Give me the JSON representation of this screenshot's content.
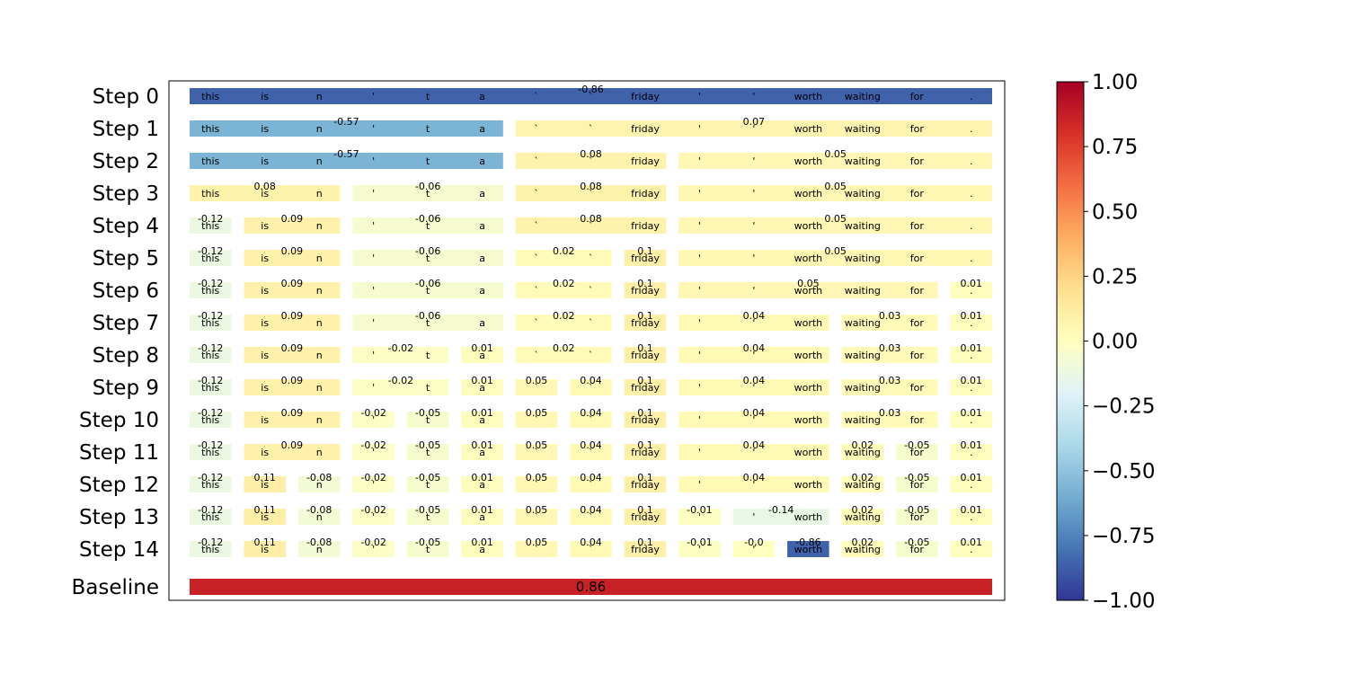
{
  "chart_data": {
    "type": "heatmap",
    "tokens": [
      "this",
      "is",
      "n",
      "'",
      "t",
      "a",
      "`",
      "`",
      "friday",
      "'",
      "'",
      "worth",
      "waiting",
      "for",
      "."
    ],
    "rows": [
      {
        "label": "Step 0",
        "segments": [
          {
            "start": 0,
            "end": 14,
            "value": -0.86
          }
        ]
      },
      {
        "label": "Step 1",
        "segments": [
          {
            "start": 0,
            "end": 5,
            "value": -0.57
          },
          {
            "start": 6,
            "end": 14,
            "value": 0.07
          }
        ]
      },
      {
        "label": "Step 2",
        "segments": [
          {
            "start": 0,
            "end": 5,
            "value": -0.57
          },
          {
            "start": 6,
            "end": 8,
            "value": 0.08
          },
          {
            "start": 9,
            "end": 14,
            "value": 0.05
          }
        ]
      },
      {
        "label": "Step 3",
        "segments": [
          {
            "start": 0,
            "end": 2,
            "value": 0.08
          },
          {
            "start": 3,
            "end": 5,
            "value": -0.06
          },
          {
            "start": 6,
            "end": 8,
            "value": 0.08
          },
          {
            "start": 9,
            "end": 14,
            "value": 0.05
          }
        ]
      },
      {
        "label": "Step 4",
        "segments": [
          {
            "start": 0,
            "end": 0,
            "value": -0.12
          },
          {
            "start": 1,
            "end": 2,
            "value": 0.09
          },
          {
            "start": 3,
            "end": 5,
            "value": -0.06
          },
          {
            "start": 6,
            "end": 8,
            "value": 0.08
          },
          {
            "start": 9,
            "end": 14,
            "value": 0.05
          }
        ]
      },
      {
        "label": "Step 5",
        "segments": [
          {
            "start": 0,
            "end": 0,
            "value": -0.12
          },
          {
            "start": 1,
            "end": 2,
            "value": 0.09
          },
          {
            "start": 3,
            "end": 5,
            "value": -0.06
          },
          {
            "start": 6,
            "end": 7,
            "value": 0.02
          },
          {
            "start": 8,
            "end": 8,
            "value": 0.1
          },
          {
            "start": 9,
            "end": 14,
            "value": 0.05
          }
        ]
      },
      {
        "label": "Step 6",
        "segments": [
          {
            "start": 0,
            "end": 0,
            "value": -0.12
          },
          {
            "start": 1,
            "end": 2,
            "value": 0.09
          },
          {
            "start": 3,
            "end": 5,
            "value": -0.06
          },
          {
            "start": 6,
            "end": 7,
            "value": 0.02
          },
          {
            "start": 8,
            "end": 8,
            "value": 0.1
          },
          {
            "start": 9,
            "end": 13,
            "value": 0.05
          },
          {
            "start": 14,
            "end": 14,
            "value": 0.01
          }
        ]
      },
      {
        "label": "Step 7",
        "segments": [
          {
            "start": 0,
            "end": 0,
            "value": -0.12
          },
          {
            "start": 1,
            "end": 2,
            "value": 0.09
          },
          {
            "start": 3,
            "end": 5,
            "value": -0.06
          },
          {
            "start": 6,
            "end": 7,
            "value": 0.02
          },
          {
            "start": 8,
            "end": 8,
            "value": 0.1
          },
          {
            "start": 9,
            "end": 11,
            "value": 0.04
          },
          {
            "start": 12,
            "end": 13,
            "value": 0.03
          },
          {
            "start": 14,
            "end": 14,
            "value": 0.01
          }
        ]
      },
      {
        "label": "Step 8",
        "segments": [
          {
            "start": 0,
            "end": 0,
            "value": -0.12
          },
          {
            "start": 1,
            "end": 2,
            "value": 0.09
          },
          {
            "start": 3,
            "end": 4,
            "value": -0.02
          },
          {
            "start": 5,
            "end": 5,
            "value": 0.01
          },
          {
            "start": 6,
            "end": 7,
            "value": 0.02
          },
          {
            "start": 8,
            "end": 8,
            "value": 0.1
          },
          {
            "start": 9,
            "end": 11,
            "value": 0.04
          },
          {
            "start": 12,
            "end": 13,
            "value": 0.03
          },
          {
            "start": 14,
            "end": 14,
            "value": 0.01
          }
        ]
      },
      {
        "label": "Step 9",
        "segments": [
          {
            "start": 0,
            "end": 0,
            "value": -0.12
          },
          {
            "start": 1,
            "end": 2,
            "value": 0.09
          },
          {
            "start": 3,
            "end": 4,
            "value": -0.02
          },
          {
            "start": 5,
            "end": 5,
            "value": 0.01
          },
          {
            "start": 6,
            "end": 6,
            "value": 0.05
          },
          {
            "start": 7,
            "end": 7,
            "value": 0.04
          },
          {
            "start": 8,
            "end": 8,
            "value": 0.1
          },
          {
            "start": 9,
            "end": 11,
            "value": 0.04
          },
          {
            "start": 12,
            "end": 13,
            "value": 0.03
          },
          {
            "start": 14,
            "end": 14,
            "value": 0.01
          }
        ]
      },
      {
        "label": "Step 10",
        "segments": [
          {
            "start": 0,
            "end": 0,
            "value": -0.12
          },
          {
            "start": 1,
            "end": 2,
            "value": 0.09
          },
          {
            "start": 3,
            "end": 3,
            "value": -0.02
          },
          {
            "start": 4,
            "end": 4,
            "value": -0.05
          },
          {
            "start": 5,
            "end": 5,
            "value": 0.01
          },
          {
            "start": 6,
            "end": 6,
            "value": 0.05
          },
          {
            "start": 7,
            "end": 7,
            "value": 0.04
          },
          {
            "start": 8,
            "end": 8,
            "value": 0.1
          },
          {
            "start": 9,
            "end": 11,
            "value": 0.04
          },
          {
            "start": 12,
            "end": 13,
            "value": 0.03
          },
          {
            "start": 14,
            "end": 14,
            "value": 0.01
          }
        ]
      },
      {
        "label": "Step 11",
        "segments": [
          {
            "start": 0,
            "end": 0,
            "value": -0.12
          },
          {
            "start": 1,
            "end": 2,
            "value": 0.09
          },
          {
            "start": 3,
            "end": 3,
            "value": -0.02
          },
          {
            "start": 4,
            "end": 4,
            "value": -0.05
          },
          {
            "start": 5,
            "end": 5,
            "value": 0.01
          },
          {
            "start": 6,
            "end": 6,
            "value": 0.05
          },
          {
            "start": 7,
            "end": 7,
            "value": 0.04
          },
          {
            "start": 8,
            "end": 8,
            "value": 0.1
          },
          {
            "start": 9,
            "end": 11,
            "value": 0.04
          },
          {
            "start": 12,
            "end": 12,
            "value": 0.02
          },
          {
            "start": 13,
            "end": 13,
            "value": -0.05
          },
          {
            "start": 14,
            "end": 14,
            "value": 0.01
          }
        ]
      },
      {
        "label": "Step 12",
        "segments": [
          {
            "start": 0,
            "end": 0,
            "value": -0.12
          },
          {
            "start": 1,
            "end": 1,
            "value": 0.11
          },
          {
            "start": 2,
            "end": 2,
            "value": -0.08
          },
          {
            "start": 3,
            "end": 3,
            "value": -0.02
          },
          {
            "start": 4,
            "end": 4,
            "value": -0.05
          },
          {
            "start": 5,
            "end": 5,
            "value": 0.01
          },
          {
            "start": 6,
            "end": 6,
            "value": 0.05
          },
          {
            "start": 7,
            "end": 7,
            "value": 0.04
          },
          {
            "start": 8,
            "end": 8,
            "value": 0.1
          },
          {
            "start": 9,
            "end": 11,
            "value": 0.04
          },
          {
            "start": 12,
            "end": 12,
            "value": 0.02
          },
          {
            "start": 13,
            "end": 13,
            "value": -0.05
          },
          {
            "start": 14,
            "end": 14,
            "value": 0.01
          }
        ]
      },
      {
        "label": "Step 13",
        "segments": [
          {
            "start": 0,
            "end": 0,
            "value": -0.12
          },
          {
            "start": 1,
            "end": 1,
            "value": 0.11
          },
          {
            "start": 2,
            "end": 2,
            "value": -0.08
          },
          {
            "start": 3,
            "end": 3,
            "value": -0.02
          },
          {
            "start": 4,
            "end": 4,
            "value": -0.05
          },
          {
            "start": 5,
            "end": 5,
            "value": 0.01
          },
          {
            "start": 6,
            "end": 6,
            "value": 0.05
          },
          {
            "start": 7,
            "end": 7,
            "value": 0.04
          },
          {
            "start": 8,
            "end": 8,
            "value": 0.1
          },
          {
            "start": 9,
            "end": 9,
            "value": -0.01
          },
          {
            "start": 10,
            "end": 11,
            "value": -0.14
          },
          {
            "start": 12,
            "end": 12,
            "value": 0.02
          },
          {
            "start": 13,
            "end": 13,
            "value": -0.05
          },
          {
            "start": 14,
            "end": 14,
            "value": 0.01
          }
        ]
      },
      {
        "label": "Step 14",
        "segments": [
          {
            "start": 0,
            "end": 0,
            "value": -0.12
          },
          {
            "start": 1,
            "end": 1,
            "value": 0.11
          },
          {
            "start": 2,
            "end": 2,
            "value": -0.08
          },
          {
            "start": 3,
            "end": 3,
            "value": -0.02
          },
          {
            "start": 4,
            "end": 4,
            "value": -0.05
          },
          {
            "start": 5,
            "end": 5,
            "value": 0.01
          },
          {
            "start": 6,
            "end": 6,
            "value": 0.05
          },
          {
            "start": 7,
            "end": 7,
            "value": 0.04
          },
          {
            "start": 8,
            "end": 8,
            "value": 0.1
          },
          {
            "start": 9,
            "end": 9,
            "value": -0.01
          },
          {
            "start": 10,
            "end": 10,
            "value": -0.0,
            "label": "-0,0"
          },
          {
            "start": 11,
            "end": 11,
            "value": -0.86
          },
          {
            "start": 12,
            "end": 12,
            "value": 0.02
          },
          {
            "start": 13,
            "end": 13,
            "value": -0.05
          },
          {
            "start": 14,
            "end": 14,
            "value": 0.01
          }
        ]
      }
    ],
    "baseline": {
      "label": "Baseline",
      "value": 0.86
    },
    "colorbar": {
      "colormap": "RdYlBu_r",
      "range": [
        -1.0,
        1.0
      ],
      "ticks": [
        "1.00",
        "0.75",
        "0.50",
        "0.25",
        "0.00",
        "−0.25",
        "−0.50",
        "−0.75",
        "−1.00"
      ],
      "tick_values": [
        1.0,
        0.75,
        0.5,
        0.25,
        0.0,
        -0.25,
        -0.5,
        -0.75,
        -1.0
      ]
    }
  }
}
